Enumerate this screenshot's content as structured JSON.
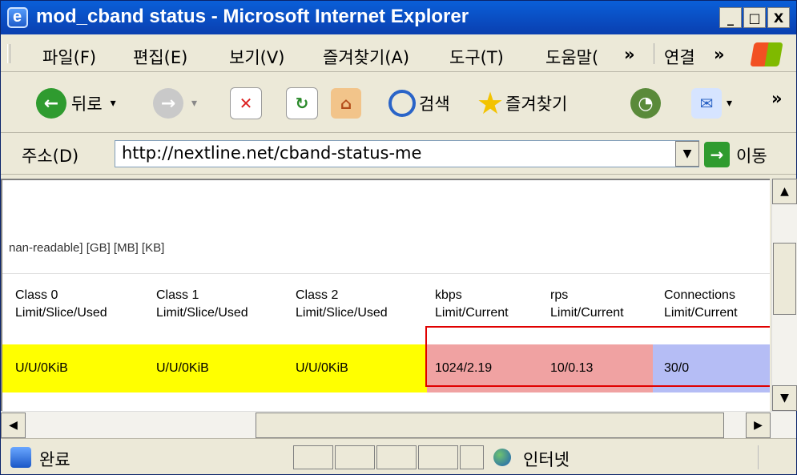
{
  "window": {
    "title": "mod_cband status - Microsoft Internet Explorer",
    "min": "_",
    "max": "□",
    "close": "X"
  },
  "menu": {
    "file": "파일(F)",
    "edit": "편집(E)",
    "view": "보기(V)",
    "favorites": "즐겨찾기(A)",
    "tools": "도구(T)",
    "help": "도움말(",
    "more": "»",
    "links": "연결",
    "links_more": "»"
  },
  "toolbar": {
    "back": "뒤로",
    "search": "검색",
    "favorites": "즐겨찾기",
    "more": "»"
  },
  "address": {
    "label": "주소(D)",
    "url": "http://nextline.net/cband-status-me",
    "go": "이동"
  },
  "content": {
    "formats": "nan-readable] [GB] [MB] [KB]",
    "headers": [
      {
        "line1": "Class 0",
        "line2": "Limit/Slice/Used"
      },
      {
        "line1": "Class 1",
        "line2": "Limit/Slice/Used"
      },
      {
        "line1": "Class 2",
        "line2": "Limit/Slice/Used"
      },
      {
        "line1": "kbps",
        "line2": "Limit/Current"
      },
      {
        "line1": "rps",
        "line2": "Limit/Current"
      },
      {
        "line1": "Connections",
        "line2": "Limit/Current"
      }
    ],
    "row": [
      "U/U/0KiB",
      "U/U/0KiB",
      "U/U/0KiB",
      "1024/2.19",
      "10/0.13",
      "30/0"
    ]
  },
  "status": {
    "text": "완료",
    "zone": "인터넷"
  }
}
